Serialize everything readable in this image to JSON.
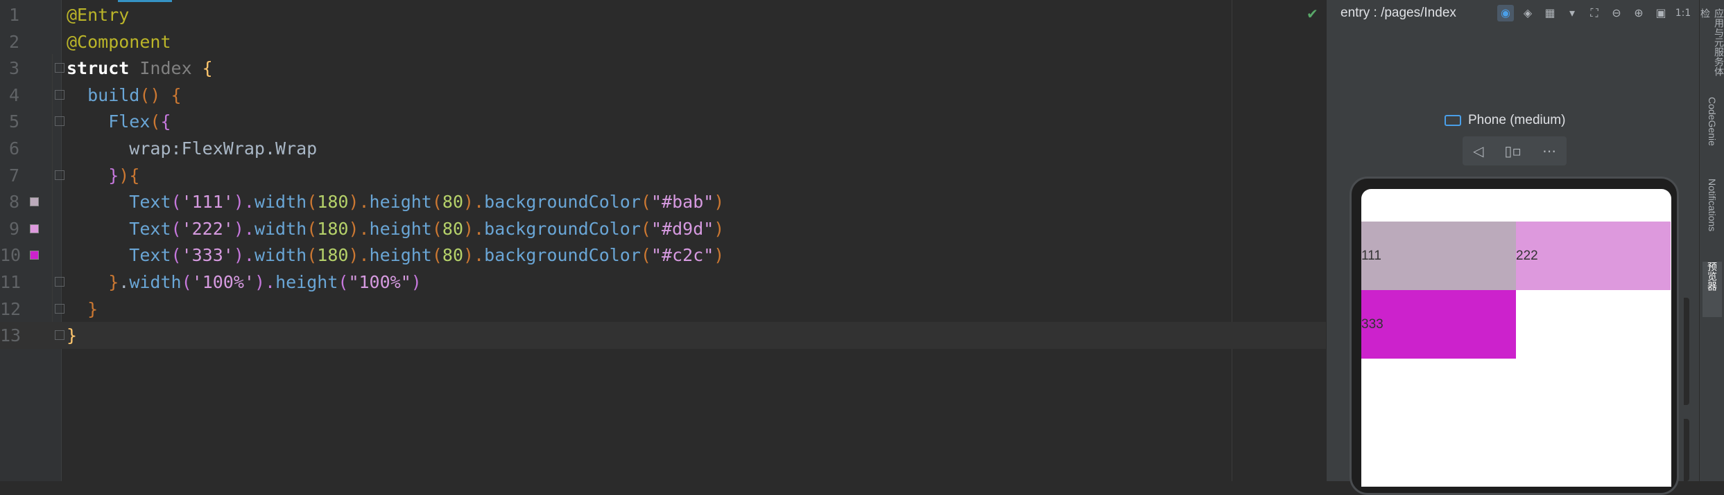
{
  "editor": {
    "lines": [
      {
        "n": "1",
        "tokens": [
          {
            "t": "@Entry",
            "c": "ann"
          }
        ]
      },
      {
        "n": "2",
        "tokens": [
          {
            "t": "@Component",
            "c": "ann"
          }
        ]
      },
      {
        "n": "3",
        "tokens": [
          {
            "t": "struct ",
            "c": "kw2"
          },
          {
            "t": "Index ",
            "c": "type"
          },
          {
            "t": "{",
            "c": "brace-y"
          }
        ]
      },
      {
        "n": "4",
        "tokens": [
          {
            "t": "  build",
            "c": "fn"
          },
          {
            "t": "() ",
            "c": "brace-o"
          },
          {
            "t": "{",
            "c": "brace-o"
          }
        ]
      },
      {
        "n": "5",
        "tokens": [
          {
            "t": "    Flex",
            "c": "fn"
          },
          {
            "t": "(",
            "c": "brace-o"
          },
          {
            "t": "{",
            "c": "brace-p"
          }
        ]
      },
      {
        "n": "6",
        "tokens": [
          {
            "t": "      wrap:FlexWrap.Wrap",
            "c": "plain"
          }
        ]
      },
      {
        "n": "7",
        "tokens": [
          {
            "t": "    }",
            "c": "brace-p"
          },
          {
            "t": "){",
            "c": "brace-o"
          }
        ]
      },
      {
        "n": "8",
        "tokens": [
          {
            "t": "      Text",
            "c": "fn"
          },
          {
            "t": "(",
            "c": "brace-p"
          },
          {
            "t": "'111'",
            "c": "str2"
          },
          {
            "t": ").",
            "c": "brace-p"
          },
          {
            "t": "width",
            "c": "fn"
          },
          {
            "t": "(",
            "c": "brace-o"
          },
          {
            "t": "180",
            "c": "num2"
          },
          {
            "t": ").",
            "c": "brace-o"
          },
          {
            "t": "height",
            "c": "fn"
          },
          {
            "t": "(",
            "c": "brace-o"
          },
          {
            "t": "80",
            "c": "num2"
          },
          {
            "t": ").",
            "c": "brace-o"
          },
          {
            "t": "backgroundColor",
            "c": "fn"
          },
          {
            "t": "(",
            "c": "brace-o"
          },
          {
            "t": "\"#bab\"",
            "c": "str2"
          },
          {
            "t": ")",
            "c": "brace-o"
          }
        ]
      },
      {
        "n": "9",
        "tokens": [
          {
            "t": "      Text",
            "c": "fn"
          },
          {
            "t": "(",
            "c": "brace-p"
          },
          {
            "t": "'222'",
            "c": "str2"
          },
          {
            "t": ").",
            "c": "brace-p"
          },
          {
            "t": "width",
            "c": "fn"
          },
          {
            "t": "(",
            "c": "brace-o"
          },
          {
            "t": "180",
            "c": "num2"
          },
          {
            "t": ").",
            "c": "brace-o"
          },
          {
            "t": "height",
            "c": "fn"
          },
          {
            "t": "(",
            "c": "brace-o"
          },
          {
            "t": "80",
            "c": "num2"
          },
          {
            "t": ").",
            "c": "brace-o"
          },
          {
            "t": "backgroundColor",
            "c": "fn"
          },
          {
            "t": "(",
            "c": "brace-o"
          },
          {
            "t": "\"#d9d\"",
            "c": "str2"
          },
          {
            "t": ")",
            "c": "brace-o"
          }
        ]
      },
      {
        "n": "10",
        "tokens": [
          {
            "t": "      Text",
            "c": "fn"
          },
          {
            "t": "(",
            "c": "brace-p"
          },
          {
            "t": "'333'",
            "c": "str2"
          },
          {
            "t": ").",
            "c": "brace-p"
          },
          {
            "t": "width",
            "c": "fn"
          },
          {
            "t": "(",
            "c": "brace-o"
          },
          {
            "t": "180",
            "c": "num2"
          },
          {
            "t": ").",
            "c": "brace-o"
          },
          {
            "t": "height",
            "c": "fn"
          },
          {
            "t": "(",
            "c": "brace-o"
          },
          {
            "t": "80",
            "c": "num2"
          },
          {
            "t": ").",
            "c": "brace-o"
          },
          {
            "t": "backgroundColor",
            "c": "fn"
          },
          {
            "t": "(",
            "c": "brace-o"
          },
          {
            "t": "\"#c2c\"",
            "c": "str2"
          },
          {
            "t": ")",
            "c": "brace-o"
          }
        ]
      },
      {
        "n": "11",
        "tokens": [
          {
            "t": "    }",
            "c": "brace-o"
          },
          {
            "t": ".",
            "c": "plain"
          },
          {
            "t": "width",
            "c": "fn"
          },
          {
            "t": "(",
            "c": "brace-p"
          },
          {
            "t": "'100%'",
            "c": "str2"
          },
          {
            "t": ").",
            "c": "brace-p"
          },
          {
            "t": "height",
            "c": "fn"
          },
          {
            "t": "(",
            "c": "brace-p"
          },
          {
            "t": "\"100%\"",
            "c": "str2"
          },
          {
            "t": ")",
            "c": "brace-p"
          }
        ]
      },
      {
        "n": "12",
        "tokens": [
          {
            "t": "  }",
            "c": "brace-o"
          }
        ]
      },
      {
        "n": "13",
        "tokens": [
          {
            "t": "}",
            "c": "brace-y"
          }
        ]
      }
    ],
    "swatches": {
      "8": "#bbaabb",
      "9": "#dd99dd",
      "10": "#cc22cc"
    },
    "current_line": "13"
  },
  "preview": {
    "title": "entry : /pages/Index",
    "device": "Phone (medium)",
    "boxes": [
      {
        "label": "111",
        "color": "#bbaabb"
      },
      {
        "label": "222",
        "color": "#dd99dd"
      },
      {
        "label": "333",
        "color": "#cc22cc"
      }
    ]
  },
  "strip": {
    "items": [
      "应用与元服务体检",
      "CodeGenie",
      "Notifications",
      "预览器"
    ]
  },
  "colors": {
    "accent": "#4a9fe8",
    "check": "#59a869"
  }
}
